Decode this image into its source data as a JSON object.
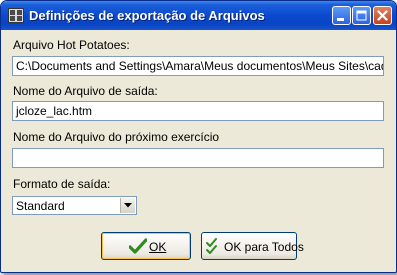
{
  "window": {
    "title": "Definições de exportação de Arquivos"
  },
  "fields": {
    "hot_potatoes_label": "Arquivo Hot Potatoes:",
    "hot_potatoes_value": "C:\\Documents and Settings\\Amara\\Meus documentos\\Meus Sites\\caderr",
    "output_name_label": "Nome do Arquivo de saída:",
    "output_name_value": "jcloze_lac.htm",
    "next_exercise_label": "Nome do Arquivo do próximo exercício",
    "next_exercise_value": "",
    "format_label": "Formato de saída:",
    "format_value": "Standard"
  },
  "buttons": {
    "ok_label": "OK",
    "ok_all_label": "OK para Todos"
  },
  "colors": {
    "titlebar": "#0a4ad0",
    "dialog_bg": "#ece9d8",
    "close_button": "#c8421d",
    "ok_check": "#2e8b1e"
  }
}
